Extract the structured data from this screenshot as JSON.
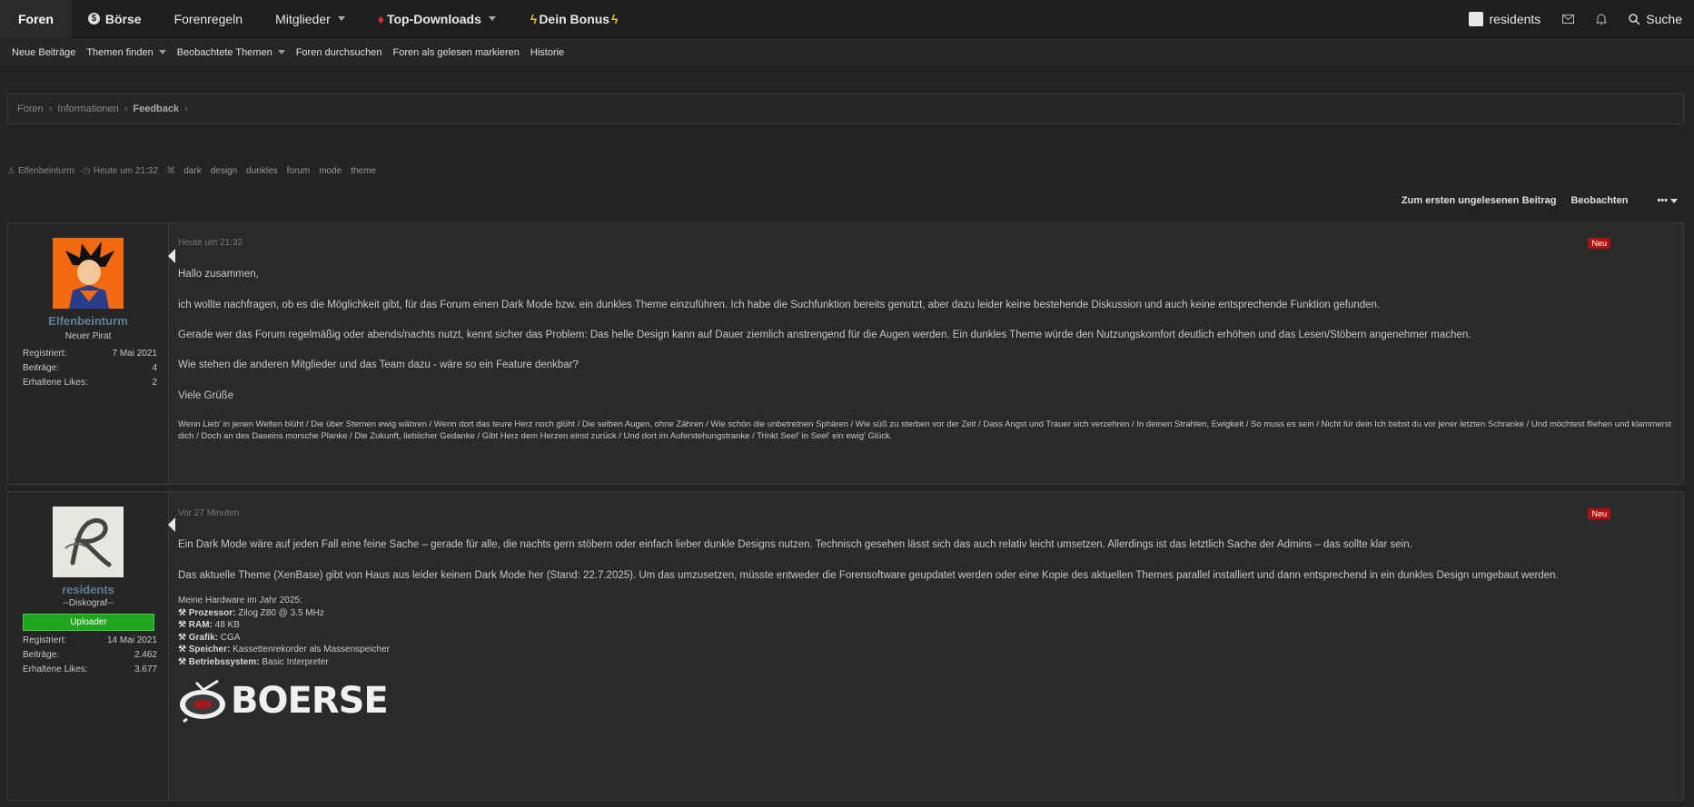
{
  "topnav": {
    "tabs": [
      {
        "label": "Foren"
      },
      {
        "label": "Börse"
      },
      {
        "label": "Forenregeln"
      },
      {
        "label": "Mitglieder"
      },
      {
        "label": "Top-Downloads"
      },
      {
        "label": "Dein Bonus"
      }
    ],
    "user": "residents",
    "search": "Suche"
  },
  "subnav": {
    "items": [
      "Neue Beiträge",
      "Themen finden",
      "Beobachtete Themen",
      "Foren durchsuchen",
      "Foren als gelesen markieren",
      "Historie"
    ]
  },
  "breadcrumb": [
    "Foren",
    "Informationen",
    "Feedback"
  ],
  "thread_meta": {
    "author": "Elfenbeinturm",
    "time": "Heute um 21:32",
    "tags": [
      "dark",
      "design",
      "dunkles",
      "forum",
      "mode",
      "theme"
    ]
  },
  "thread_actions": {
    "first_unread": "Zum ersten ungelesenen Beitrag",
    "watch": "Beobachten",
    "more": "•••"
  },
  "posts": [
    {
      "username": "Elfenbeinturm",
      "user_title": "Neuer Pirat",
      "stats": [
        {
          "label": "Registriert:",
          "value": "7 Mai 2021"
        },
        {
          "label": "Beiträge:",
          "value": "4"
        },
        {
          "label": "Erhaltene Likes:",
          "value": "2"
        }
      ],
      "time": "Heute um 21:32",
      "badge": "Neu",
      "paragraphs": [
        "Hallo zusammen,",
        "ich wollte nachfragen, ob es die Möglichkeit gibt, für das Forum einen Dark Mode bzw. ein dunkles Theme einzuführen. Ich habe die Suchfunktion bereits genutzt, aber dazu leider keine bestehende Diskussion und auch keine entsprechende Funktion gefunden.",
        "Gerade wer das Forum regelmäßig oder abends/nachts nutzt, kennt sicher das Problem: Das helle Design kann auf Dauer ziemlich anstrengend für die Augen werden. Ein dunkles Theme würde den Nutzungskomfort deutlich erhöhen und das Lesen/Stöbern angenehmer machen.",
        "Wie stehen die anderen Mitglieder und das Team dazu - wäre so ein Feature denkbar?",
        "Viele Grüße"
      ],
      "signature": "Wenn Lieb' in jenen Welten blüht / Die über Sternen ewig währen / Wenn dort das teure Herz noch glüht / Die selben Augen, ohne Zähren / Wie schön die unbetretnen Sphären / Wie süß zu sterben vor der Zeit / Dass Angst und Trauer sich verzehren / In deinen Strahlen, Ewigkeit / So muss es sein / Nicht für dein Ich bebst du vor jener letzten Schranke / Und möchtest fliehen und klammerst dich / Doch an des Daseins morsche Planke / Die Zukunft, lieblicher Gedanke / Gibt Herz dem Herzen einst zurück / Und dort im Auferstehungstranke / Trinkt Seel' in Seel' ein ewig' Glück."
    },
    {
      "username": "residents",
      "user_title": "--Diskograf--",
      "banner": "Uploader",
      "stats": [
        {
          "label": "Registriert:",
          "value": "14 Mai 2021"
        },
        {
          "label": "Beiträge:",
          "value": "2.462"
        },
        {
          "label": "Erhaltene Likes:",
          "value": "3.677"
        }
      ],
      "time": "Vor 27 Minuten",
      "badge": "Neu",
      "paragraphs": [
        "Ein Dark Mode wäre auf jeden Fall eine feine Sache – gerade für alle, die nachts gern stöbern oder einfach lieber dunkle Designs nutzen. Technisch gesehen lässt sich das auch relativ leicht umsetzen. Allerdings ist das letztlich Sache der Admins – das sollte klar sein.",
        "Das aktuelle Theme (XenBase) gibt von Haus aus leider keinen Dark Mode her (Stand: 22.7.2025). Um das umzusetzen, müsste entweder die Forensoftware geupdatet werden oder eine Kopie des aktuellen Themes parallel installiert und dann entsprechend in ein dunkles Design umgebaut werden."
      ],
      "hardware_title": "Meine Hardware im Jahr 2025:",
      "hardware": [
        {
          "label": "Prozessor:",
          "value": "Zilog Z80 @ 3.5 MHz"
        },
        {
          "label": "RAM:",
          "value": "48 KB"
        },
        {
          "label": "Grafik:",
          "value": "CGA"
        },
        {
          "label": "Speicher:",
          "value": "Kassettenrekorder als Massenspeicher"
        },
        {
          "label": "Betriebssystem:",
          "value": "Basic Interpreter"
        }
      ],
      "logo_text": "BOERSE"
    }
  ],
  "colors": {
    "accent_badge": "#b01010",
    "uploader_banner": "#1fa51f",
    "username": "#5f7f95"
  }
}
